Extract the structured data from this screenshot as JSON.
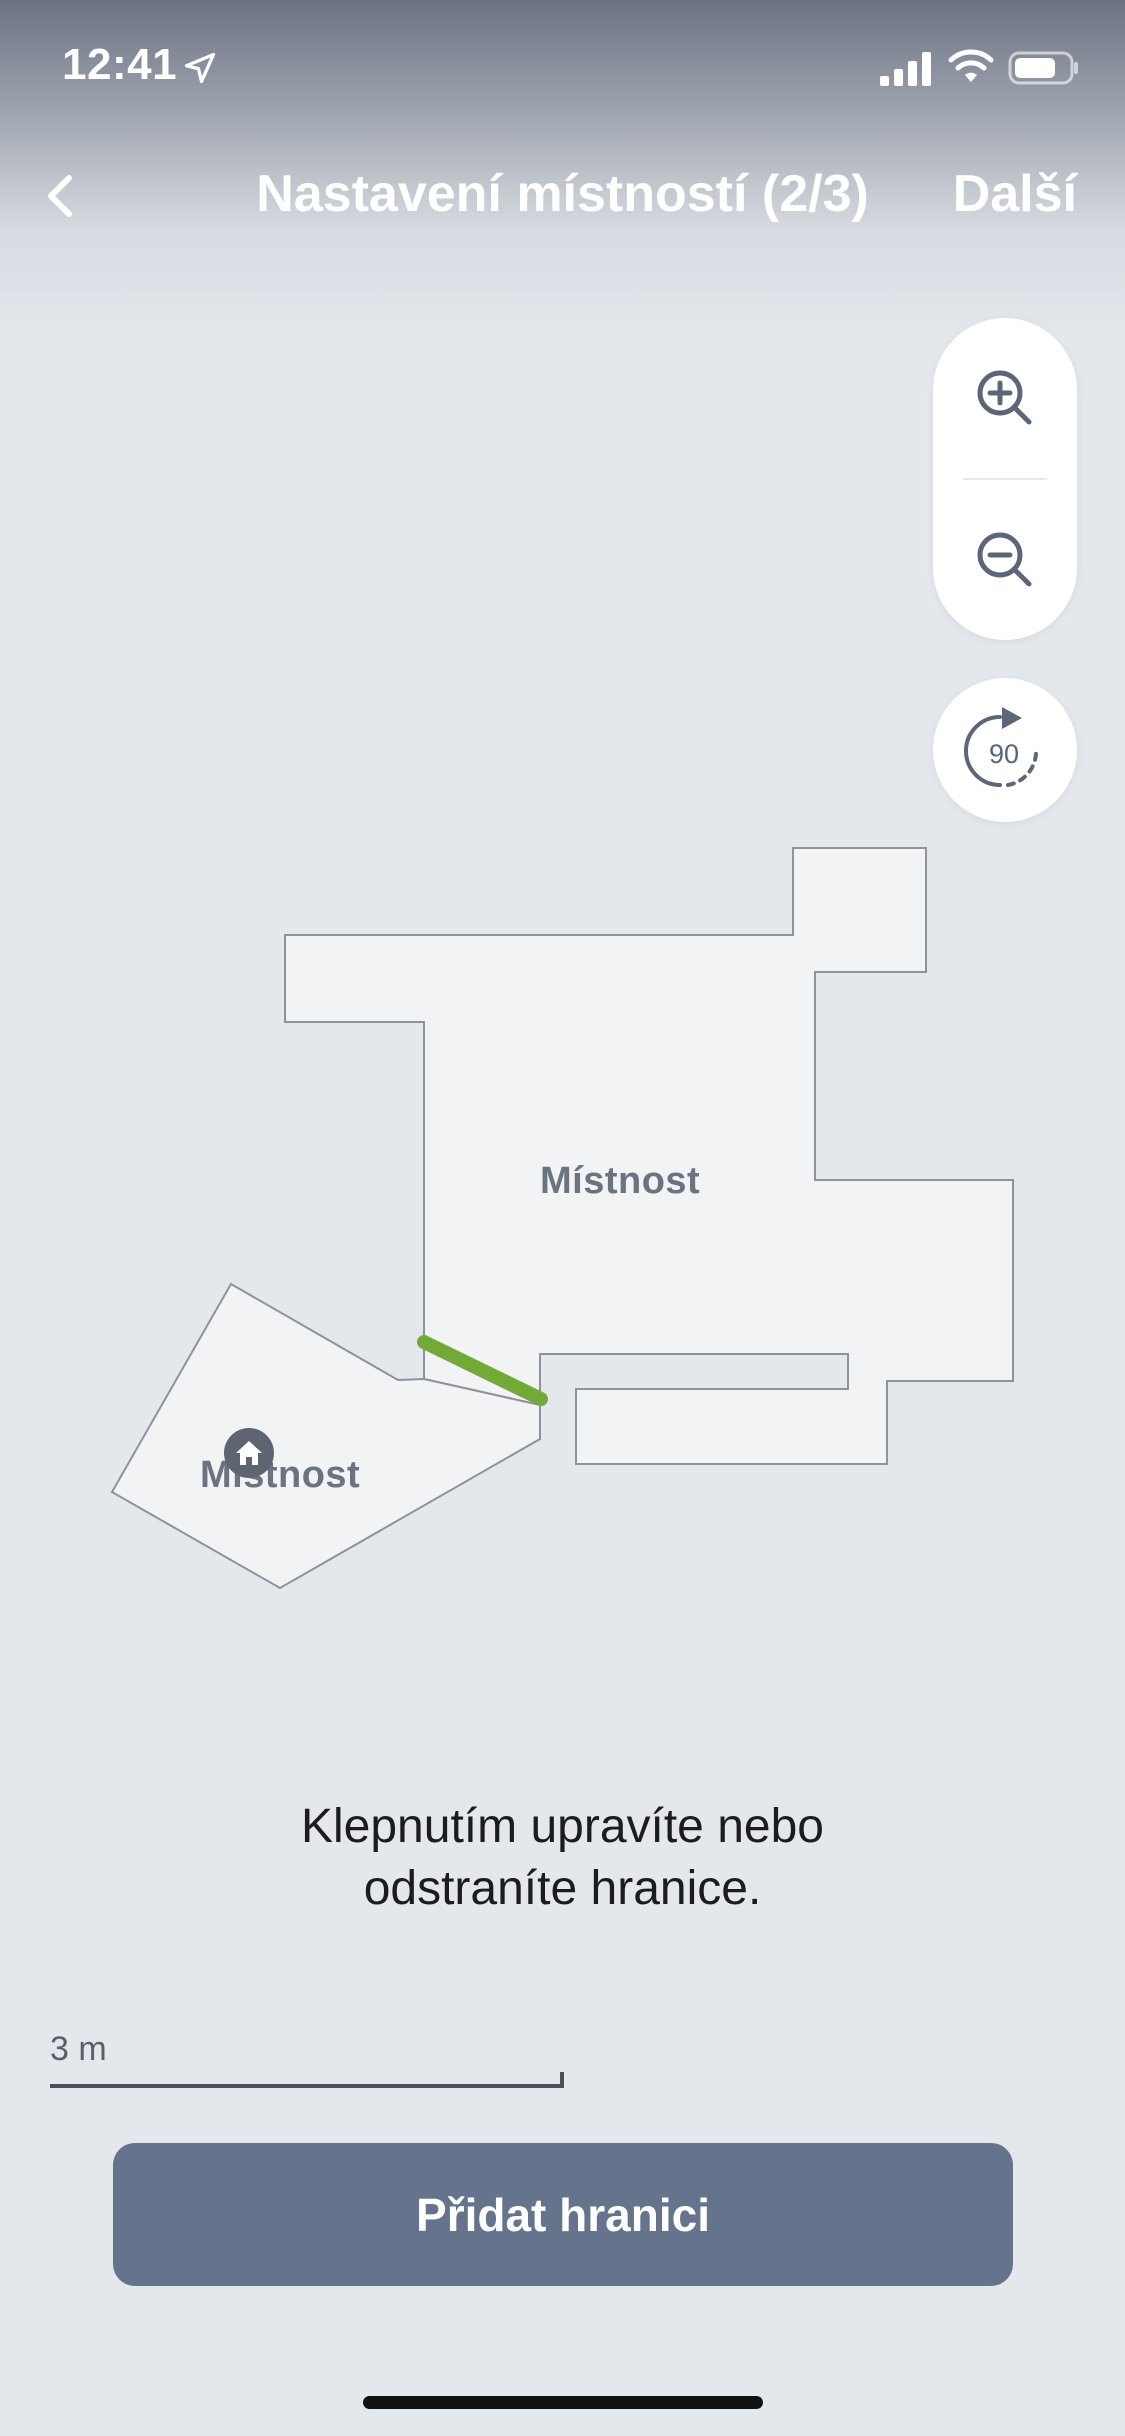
{
  "status_bar": {
    "time": "12:41",
    "icons": [
      "location-arrow-icon",
      "cellular-signal-icon",
      "wifi-icon",
      "battery-icon"
    ]
  },
  "nav": {
    "back_icon": "chevron-left-icon",
    "title": "Nastavení místností (2/3)",
    "next_label": "Další"
  },
  "map_controls": {
    "zoom_in_icon": "zoom-in-icon",
    "zoom_out_icon": "zoom-out-icon",
    "rotate_label": "90",
    "rotate_icon": "rotate-icon"
  },
  "map": {
    "rooms": [
      {
        "label": "Místnost"
      },
      {
        "label": "Místnost"
      }
    ],
    "boundary_color": "#72a937",
    "dock_icon": "home-icon"
  },
  "instruction": {
    "line1": "Klepnutím upravíte nebo",
    "line2": "odstraníte hranice."
  },
  "scale": {
    "label": "3 m"
  },
  "actions": {
    "add_boundary_label": "Přidat hranici"
  },
  "colors": {
    "button_bg": "#65748c",
    "room_fill": "#f2f3f5",
    "room_stroke": "#8e939b",
    "background": "#e4e7ec"
  }
}
